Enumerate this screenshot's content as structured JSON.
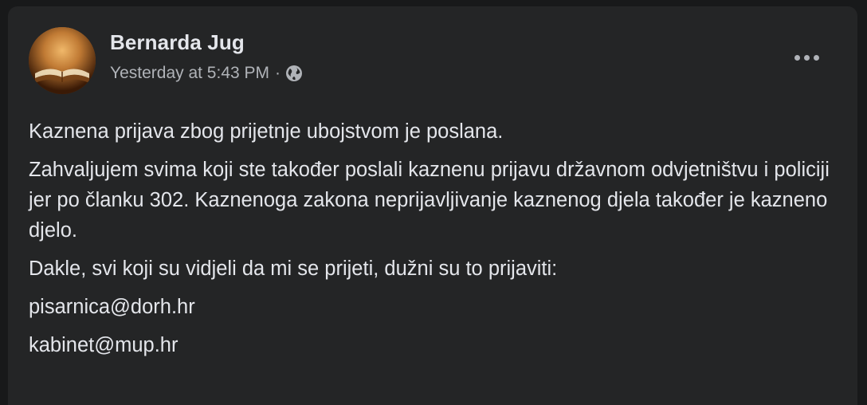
{
  "post": {
    "author": "Bernarda Jug",
    "timestamp": "Yesterday at 5:43 PM",
    "separator": "·",
    "privacy_icon": "globe-icon",
    "more_icon": "more-options-icon",
    "paragraphs": {
      "p1": "Kaznena prijava zbog prijetnje ubojstvom je poslana.",
      "p2": "Zahvaljujem svima koji ste također poslali kaznenu prijavu državnom odvjetništvu i policiji jer po članku 302. Kaznenoga zakona neprijavljivanje kaznenog djela također je kazneno djelo.",
      "p3": "Dakle, svi koji su vidjeli da mi se prijeti, dužni su to prijaviti:",
      "email1": "pisarnica@dorh.hr",
      "email2": "kabinet@mup.hr"
    }
  },
  "colors": {
    "page_bg": "#18191a",
    "card_bg": "#242526",
    "primary_text": "#e4e6eb",
    "secondary_text": "#b0b3b8"
  }
}
